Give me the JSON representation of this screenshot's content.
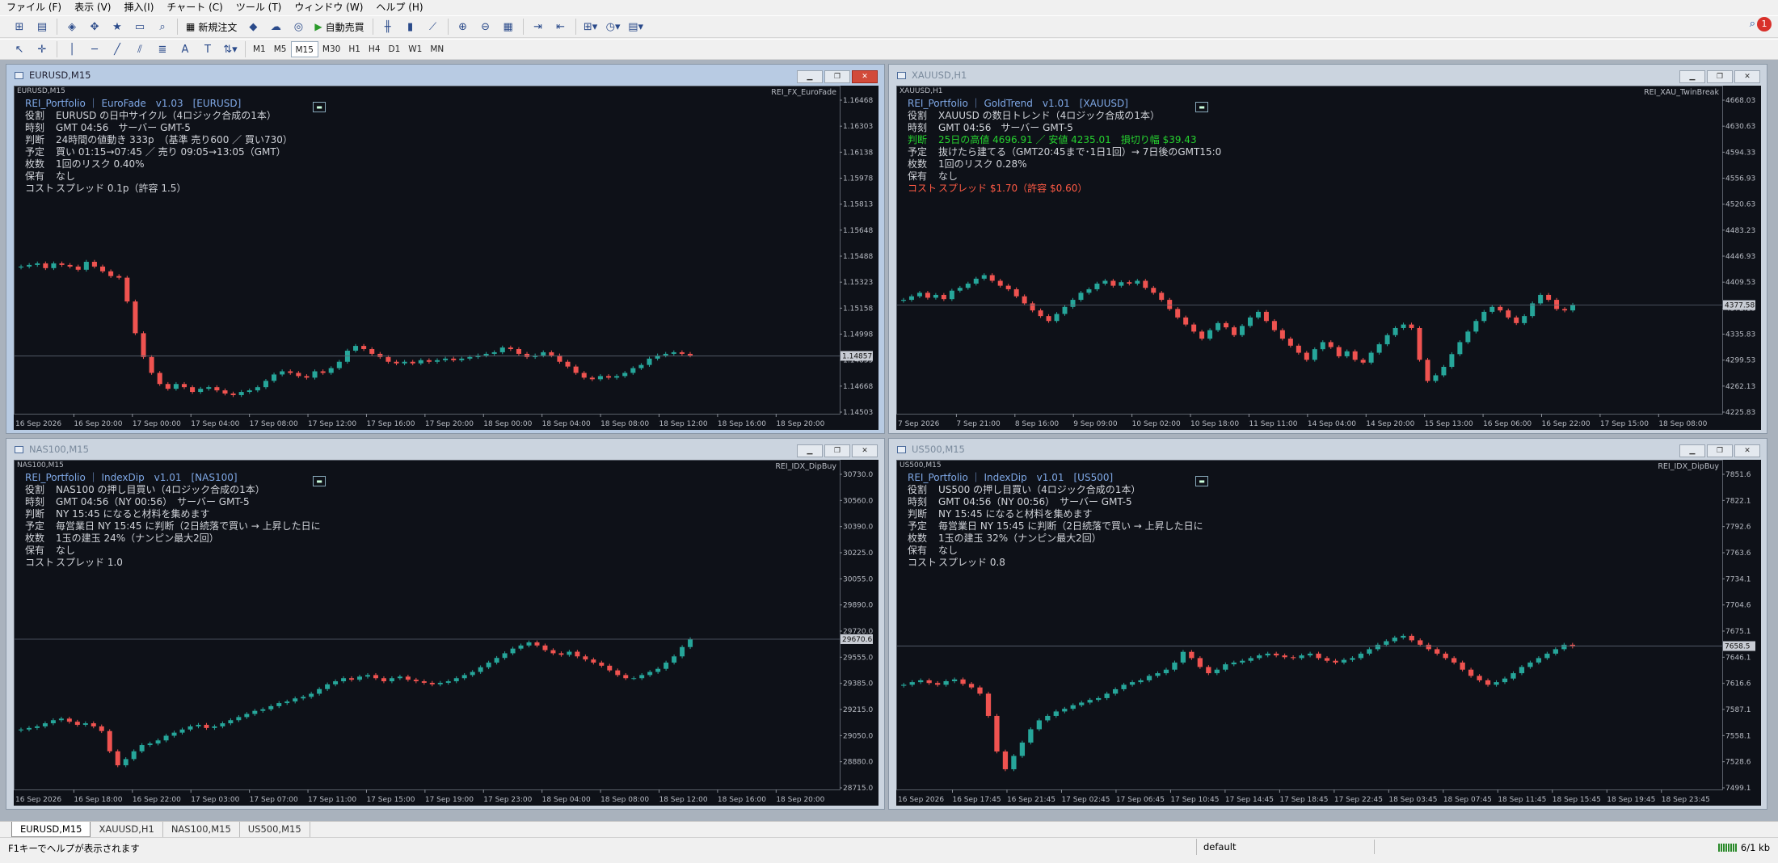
{
  "menu": [
    "ファイル (F)",
    "表示 (V)",
    "挿入(I)",
    "チャート (C)",
    "ツール (T)",
    "ウィンドウ (W)",
    "ヘルプ (H)"
  ],
  "toolbar": {
    "new_order": "新規注文",
    "auto_trade": "自動売買"
  },
  "timeframes": [
    "M1",
    "M5",
    "M15",
    "M30",
    "H1",
    "H4",
    "D1",
    "W1",
    "MN"
  ],
  "active_timeframe": "M15",
  "tool_text_label": "A",
  "notification_count": "1",
  "charts": [
    {
      "title": "EURUSD,M15",
      "symbol": "EURUSD,M15",
      "ea": "REI_FX_EuroFade",
      "header": "REI_Portfolio ｜ EuroFade　v1.03　[EURUSD]",
      "lines": [
        [
          "役割",
          "EURUSD の日中サイクル（4ロジック合成の1本）",
          ""
        ],
        [
          "時刻",
          "GMT 04:56　サーバー GMT-5",
          ""
        ],
        [
          "判断",
          "24時間の値動き 333p　（基準 売り600 ／ 買い730）",
          ""
        ],
        [
          "予定",
          "買い 01:15→07:45 ／ 売り 09:05→13:05（GMT）",
          ""
        ],
        [
          "枚数",
          "1回のリスク 0.40%",
          ""
        ],
        [
          "保有",
          "なし",
          ""
        ],
        [
          "コスト",
          "スプレッド 0.1p（許容 1.5）",
          ""
        ]
      ],
      "yticks": [
        "1.16468",
        "1.16303",
        "1.16138",
        "1.15978",
        "1.15813",
        "1.15648",
        "1.15488",
        "1.15323",
        "1.15158",
        "1.14998",
        "1.14833",
        "1.14668",
        "1.14503"
      ],
      "xticks": [
        "16 Sep 2026",
        "16 Sep 20:00",
        "17 Sep 00:00",
        "17 Sep 04:00",
        "17 Sep 08:00",
        "17 Sep 12:00",
        "17 Sep 16:00",
        "17 Sep 20:00",
        "18 Sep 00:00",
        "18 Sep 04:00",
        "18 Sep 08:00",
        "18 Sep 12:00",
        "18 Sep 16:00",
        "18 Sep 20:00"
      ],
      "price": "1.14857",
      "ymin": 1.14503,
      "ymax": 1.16468,
      "path": [
        1.1542,
        1.1543,
        1.1544,
        1.1541,
        1.1544,
        1.1543,
        1.1542,
        1.154,
        1.1545,
        1.1542,
        1.1539,
        1.1536,
        1.1535,
        1.152,
        1.15,
        1.1485,
        1.1475,
        1.1468,
        1.1465,
        1.1468,
        1.1466,
        1.1463,
        1.1465,
        1.1466,
        1.1464,
        1.1462,
        1.1461,
        1.1463,
        1.1464,
        1.1466,
        1.147,
        1.1474,
        1.1476,
        1.1475,
        1.1473,
        1.1472,
        1.1476,
        1.1475,
        1.1478,
        1.1482,
        1.1489,
        1.1492,
        1.149,
        1.1487,
        1.1485,
        1.1482,
        1.1481,
        1.1482,
        1.1481,
        1.1483,
        1.1482,
        1.1483,
        1.1484,
        1.1483,
        1.1484,
        1.1485,
        1.1486,
        1.1487,
        1.1488,
        1.1491,
        1.149,
        1.1487,
        1.1485,
        1.1486,
        1.1488,
        1.1486,
        1.1482,
        1.1479,
        1.1475,
        1.1472,
        1.1471,
        1.1473,
        1.1472,
        1.1473,
        1.1475,
        1.1478,
        1.148,
        1.1484,
        1.1486,
        1.1487,
        1.1488,
        1.1487,
        1.1486
      ]
    },
    {
      "title": "XAUUSD,H1",
      "symbol": "XAUUSD,H1",
      "ea": "REI_XAU_TwinBreak",
      "header": "REI_Portfolio ｜ GoldTrend　v1.01　[XAUUSD]",
      "lines": [
        [
          "役割",
          "XAUUSD の数日トレンド（4ロジック合成の1本）",
          ""
        ],
        [
          "時刻",
          "GMT 04:56　サーバー GMT-5",
          ""
        ],
        [
          "判断",
          "25日の高値 4696.91 ／ 安値 4235.01　損切り幅 $39.43",
          "g"
        ],
        [
          "予定",
          "抜けたら建てる（GMT20:45まで･1日1回）→ 7日後のGMT15:0",
          ""
        ],
        [
          "枚数",
          "1回のリスク 0.28%",
          ""
        ],
        [
          "保有",
          "なし",
          ""
        ],
        [
          "コスト",
          "スプレッド $1.70（許容 $0.60）",
          "r"
        ]
      ],
      "yticks": [
        "4668.03",
        "4630.63",
        "4594.33",
        "4556.93",
        "4520.63",
        "4483.23",
        "4446.93",
        "4409.53",
        "4372.13",
        "4335.83",
        "4299.53",
        "4262.13",
        "4225.83"
      ],
      "xticks": [
        "7 Sep 2026",
        "7 Sep 21:00",
        "8 Sep 16:00",
        "9 Sep 09:00",
        "10 Sep 02:00",
        "10 Sep 18:00",
        "11 Sep 11:00",
        "14 Sep 04:00",
        "14 Sep 20:00",
        "15 Sep 13:00",
        "16 Sep 06:00",
        "16 Sep 22:00",
        "17 Sep 15:00",
        "18 Sep 08:00"
      ],
      "price": "4377.58",
      "ymin": 4225.83,
      "ymax": 4668.03,
      "path": [
        4385,
        4390,
        4395,
        4388,
        4392,
        4386,
        4398,
        4402,
        4408,
        4415,
        4420,
        4412,
        4405,
        4400,
        4390,
        4380,
        4370,
        4362,
        4355,
        4365,
        4375,
        4385,
        4395,
        4400,
        4408,
        4412,
        4405,
        4410,
        4408,
        4412,
        4402,
        4395,
        4385,
        4372,
        4360,
        4350,
        4340,
        4330,
        4342,
        4352,
        4346,
        4335,
        4348,
        4360,
        4368,
        4355,
        4342,
        4330,
        4320,
        4310,
        4300,
        4315,
        4325,
        4318,
        4305,
        4312,
        4300,
        4296,
        4310,
        4322,
        4335,
        4345,
        4350,
        4345,
        4300,
        4270,
        4278,
        4290,
        4308,
        4325,
        4340,
        4355,
        4368,
        4375,
        4370,
        4360,
        4352,
        4362,
        4380,
        4392,
        4385,
        4372,
        4370,
        4378
      ]
    },
    {
      "title": "NAS100,M15",
      "symbol": "NAS100,M15",
      "ea": "REI_IDX_DipBuy",
      "header": "REI_Portfolio ｜ IndexDip　v1.01　[NAS100]",
      "lines": [
        [
          "役割",
          "NAS100 の押し目買い（4ロジック合成の1本）",
          ""
        ],
        [
          "時刻",
          "GMT 04:56（NY 00:56）　サーバー GMT-5",
          ""
        ],
        [
          "判断",
          "NY 15:45 になると材料を集めます",
          ""
        ],
        [
          "予定",
          "毎営業日 NY 15:45 に判断（2日続落で買い → 上昇した日に",
          ""
        ],
        [
          "枚数",
          "1玉の建玉 24%（ナンピン最大2回）",
          ""
        ],
        [
          "保有",
          "なし",
          ""
        ],
        [
          "コスト",
          "スプレッド 1.0",
          ""
        ]
      ],
      "yticks": [
        "30730.0",
        "30560.0",
        "30390.0",
        "30225.0",
        "30055.0",
        "29890.0",
        "29720.0",
        "29555.0",
        "29385.0",
        "29215.0",
        "29050.0",
        "28880.0",
        "28715.0"
      ],
      "xticks": [
        "16 Sep 2026",
        "16 Sep 18:00",
        "16 Sep 22:00",
        "17 Sep 03:00",
        "17 Sep 07:00",
        "17 Sep 11:00",
        "17 Sep 15:00",
        "17 Sep 19:00",
        "17 Sep 23:00",
        "18 Sep 04:00",
        "18 Sep 08:00",
        "18 Sep 12:00",
        "18 Sep 16:00",
        "18 Sep 20:00"
      ],
      "price": "29670.6",
      "ymin": 28715,
      "ymax": 30730,
      "path": [
        29090,
        29100,
        29110,
        29130,
        29150,
        29160,
        29140,
        29120,
        29130,
        29110,
        29080,
        28950,
        28860,
        28900,
        28950,
        28990,
        29000,
        29020,
        29050,
        29070,
        29090,
        29110,
        29120,
        29100,
        29110,
        29130,
        29150,
        29170,
        29190,
        29210,
        29220,
        29240,
        29260,
        29270,
        29290,
        29300,
        29320,
        29350,
        29380,
        29400,
        29420,
        29410,
        29430,
        29440,
        29420,
        29400,
        29420,
        29430,
        29410,
        29400,
        29390,
        29380,
        29390,
        29400,
        29420,
        29440,
        29460,
        29490,
        29520,
        29550,
        29580,
        29610,
        29630,
        29650,
        29630,
        29600,
        29580,
        29570,
        29590,
        29560,
        29540,
        29520,
        29500,
        29470,
        29440,
        29420,
        29420,
        29440,
        29460,
        29480,
        29520,
        29560,
        29620,
        29670
      ]
    },
    {
      "title": "US500,M15",
      "symbol": "US500,M15",
      "ea": "REI_IDX_DipBuy",
      "header": "REI_Portfolio ｜ IndexDip　v1.01　[US500]",
      "lines": [
        [
          "役割",
          "US500 の押し目買い（4ロジック合成の1本）",
          ""
        ],
        [
          "時刻",
          "GMT 04:56（NY 00:56）　サーバー GMT-5",
          ""
        ],
        [
          "判断",
          "NY 15:45 になると材料を集めます",
          ""
        ],
        [
          "予定",
          "毎営業日 NY 15:45 に判断（2日続落で買い → 上昇した日に",
          ""
        ],
        [
          "枚数",
          "1玉の建玉 32%（ナンピン最大2回）",
          ""
        ],
        [
          "保有",
          "なし",
          ""
        ],
        [
          "コスト",
          "スプレッド 0.8",
          ""
        ]
      ],
      "yticks": [
        "7851.6",
        "7822.1",
        "7792.6",
        "7763.6",
        "7734.1",
        "7704.6",
        "7675.1",
        "7646.1",
        "7616.6",
        "7587.1",
        "7558.1",
        "7528.6",
        "7499.1"
      ],
      "xticks": [
        "16 Sep 2026",
        "16 Sep 17:45",
        "16 Sep 21:45",
        "17 Sep 02:45",
        "17 Sep 06:45",
        "17 Sep 10:45",
        "17 Sep 14:45",
        "17 Sep 18:45",
        "17 Sep 22:45",
        "18 Sep 03:45",
        "18 Sep 07:45",
        "18 Sep 11:45",
        "18 Sep 15:45",
        "18 Sep 19:45",
        "18 Sep 23:45"
      ],
      "price": "7658.5",
      "ymin": 7499.1,
      "ymax": 7851.6,
      "path": [
        7615,
        7618,
        7620,
        7617,
        7615,
        7619,
        7621,
        7616,
        7612,
        7605,
        7580,
        7540,
        7520,
        7535,
        7550,
        7565,
        7575,
        7580,
        7585,
        7588,
        7592,
        7595,
        7598,
        7600,
        7605,
        7610,
        7615,
        7618,
        7620,
        7625,
        7628,
        7632,
        7640,
        7652,
        7645,
        7635,
        7628,
        7632,
        7638,
        7640,
        7642,
        7645,
        7648,
        7650,
        7648,
        7646,
        7645,
        7648,
        7650,
        7645,
        7642,
        7640,
        7643,
        7645,
        7650,
        7655,
        7660,
        7664,
        7668,
        7670,
        7665,
        7660,
        7655,
        7650,
        7645,
        7640,
        7632,
        7625,
        7620,
        7615,
        7618,
        7622,
        7628,
        7635,
        7640,
        7645,
        7650,
        7655,
        7660,
        7658
      ]
    }
  ],
  "tabs": [
    "EURUSD,M15",
    "XAUUSD,H1",
    "NAS100,M15",
    "US500,M15"
  ],
  "status": {
    "help": "F1キーでヘルプが表示されます",
    "profile": "default",
    "traffic": "6/1 kb"
  },
  "colors": {
    "bull": "#26a69a",
    "bear": "#ef5350",
    "background": "#0e1118"
  }
}
